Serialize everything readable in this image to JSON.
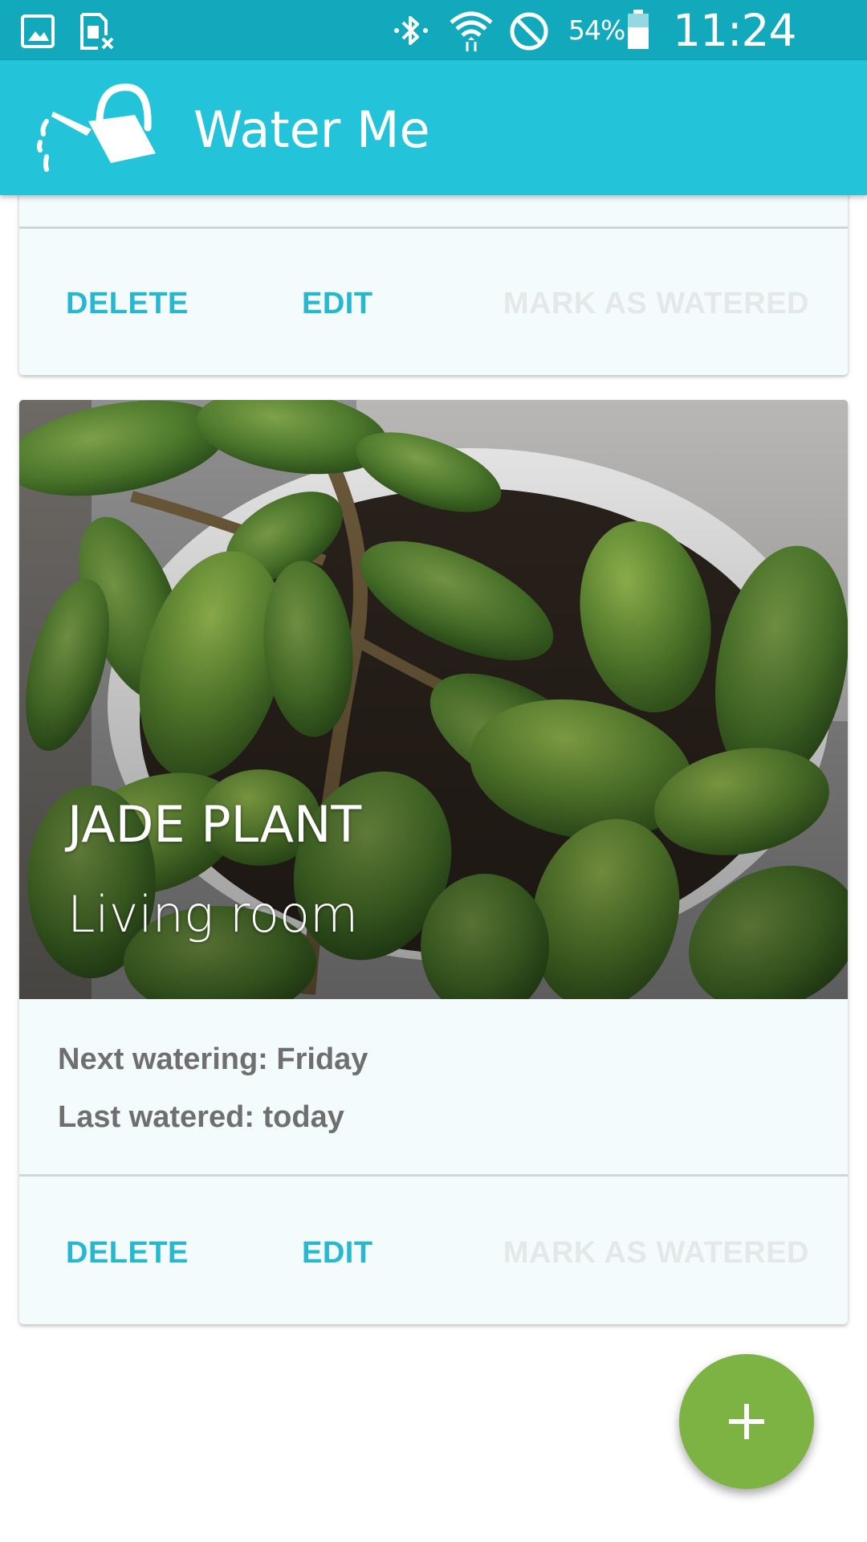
{
  "status_bar": {
    "battery_percent": "54%",
    "time": "11:24 AM",
    "icons": [
      "gallery-icon",
      "sim-card-icon",
      "bluetooth-icon",
      "wifi-icon",
      "do-not-disturb-icon",
      "battery-icon"
    ]
  },
  "app_bar": {
    "title": "Water Me",
    "logo": "watering-can-icon",
    "color": "#23c3d9"
  },
  "cards": [
    {
      "actions": {
        "delete": "DELETE",
        "edit": "EDIT",
        "mark_watered": "MARK AS WATERED"
      }
    },
    {
      "name": "JADE PLANT",
      "room": "Living room",
      "next_watering": "Next watering: Friday",
      "last_watered": "Last watered: today",
      "actions": {
        "delete": "DELETE",
        "edit": "EDIT",
        "mark_watered": "MARK AS WATERED"
      }
    }
  ],
  "fab": {
    "icon": "plus-icon",
    "color": "#7cb342"
  },
  "colors": {
    "accent": "#27b8cf",
    "disabled_action": "#e4e8e9",
    "card_background": "#f4fbfd"
  }
}
